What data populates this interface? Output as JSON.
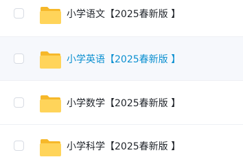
{
  "colors": {
    "folder_back": "#f6b82a",
    "folder_front": "#ffd45a",
    "hover_text": "#0a8fd0",
    "hover_bg": "#f6f8fc"
  },
  "files": [
    {
      "name": "小学语文【2025春新版 】",
      "icon": "folder-icon",
      "hover": false
    },
    {
      "name": "小学英语【2025春新版 】",
      "icon": "folder-icon",
      "hover": true
    },
    {
      "name": "小学数学【2025春新版 】",
      "icon": "folder-icon",
      "hover": false
    },
    {
      "name": "小学科学【2025春新版 】",
      "icon": "folder-icon",
      "hover": false
    }
  ]
}
